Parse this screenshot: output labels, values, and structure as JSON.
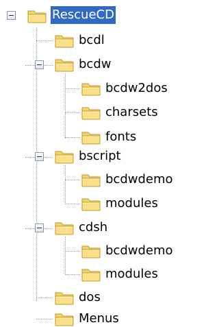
{
  "tree": {
    "root": {
      "label": "RescueCD",
      "expanded": true,
      "selected": true
    },
    "nodes": [
      {
        "label": "bcdl"
      },
      {
        "label": "bcdw",
        "expanded": true
      },
      {
        "label": "bcdw2dos"
      },
      {
        "label": "charsets"
      },
      {
        "label": "fonts"
      },
      {
        "label": "bscript",
        "expanded": true
      },
      {
        "label": "bcdwdemo"
      },
      {
        "label": "modules"
      },
      {
        "label": "cdsh",
        "expanded": true
      },
      {
        "label": "bcdwdemo"
      },
      {
        "label": "modules"
      },
      {
        "label": "dos"
      },
      {
        "label": "Menus"
      }
    ]
  },
  "colors": {
    "selection": "#316ac5",
    "folder_body": "#f5d36b",
    "folder_outline": "#c49a2a",
    "tree_lines": "#a0a0a0"
  },
  "icons": {
    "folder": "folder-icon",
    "collapse": "collapse-minus-icon"
  }
}
